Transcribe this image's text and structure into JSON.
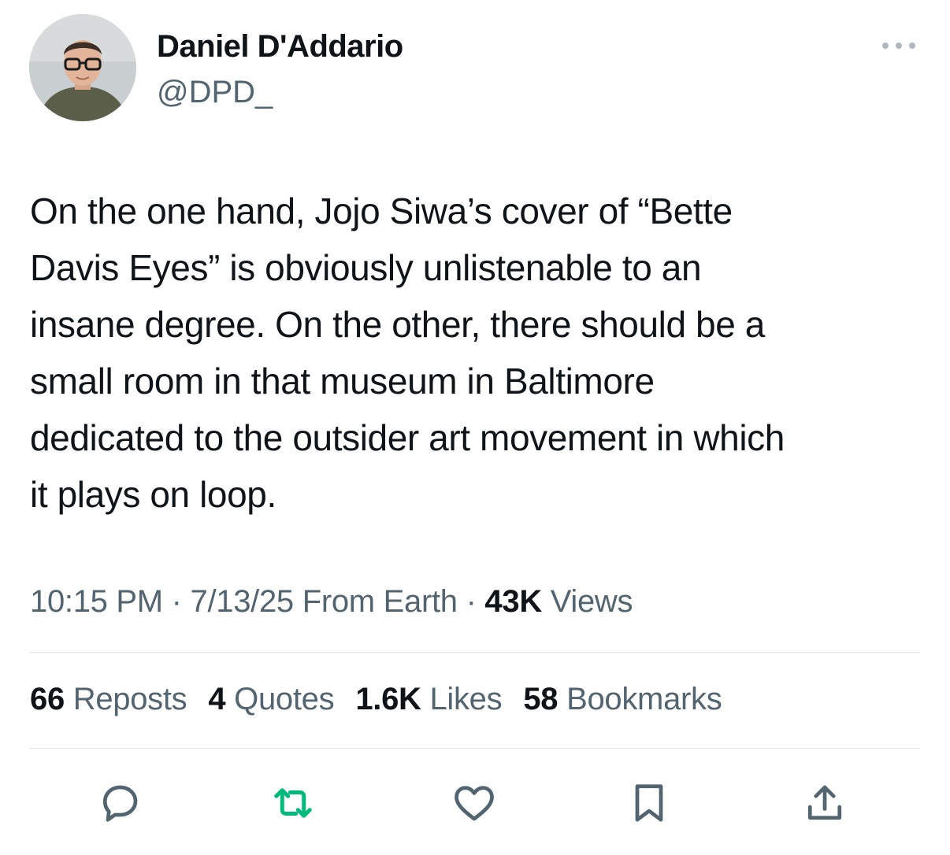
{
  "author": {
    "name": "Daniel D'Addario",
    "handle": "@DPD_"
  },
  "tweet": {
    "lines": [
      "On the one hand, Jojo Siwa’s cover of “Bette",
      "Davis Eyes” is obviously unlistenable to an",
      "insane degree. On the other, there should be a",
      "small room in that museum in Baltimore",
      "dedicated to the outsider art movement in which",
      "it plays on loop."
    ],
    "time": "10:15 PM",
    "date": "7/13/25",
    "source": "From Earth",
    "separator": "·",
    "views_count": "43K",
    "views_label": "Views"
  },
  "stats": {
    "reposts": {
      "count": "66",
      "label": "Reposts"
    },
    "quotes": {
      "count": "4",
      "label": "Quotes"
    },
    "likes": {
      "count": "1.6K",
      "label": "Likes"
    },
    "bookmarks": {
      "count": "58",
      "label": "Bookmarks"
    }
  },
  "icons": {
    "more": "more-horizontal-icon",
    "reply": "reply-icon",
    "repost": "repost-icon",
    "like": "heart-icon",
    "bookmark": "bookmark-icon",
    "share": "share-icon"
  },
  "colors": {
    "text_primary": "#0f1419",
    "text_secondary": "#536471",
    "repost_active": "#00ba7c",
    "icon_gray": "#536471",
    "divider": "#dfe3e6"
  }
}
